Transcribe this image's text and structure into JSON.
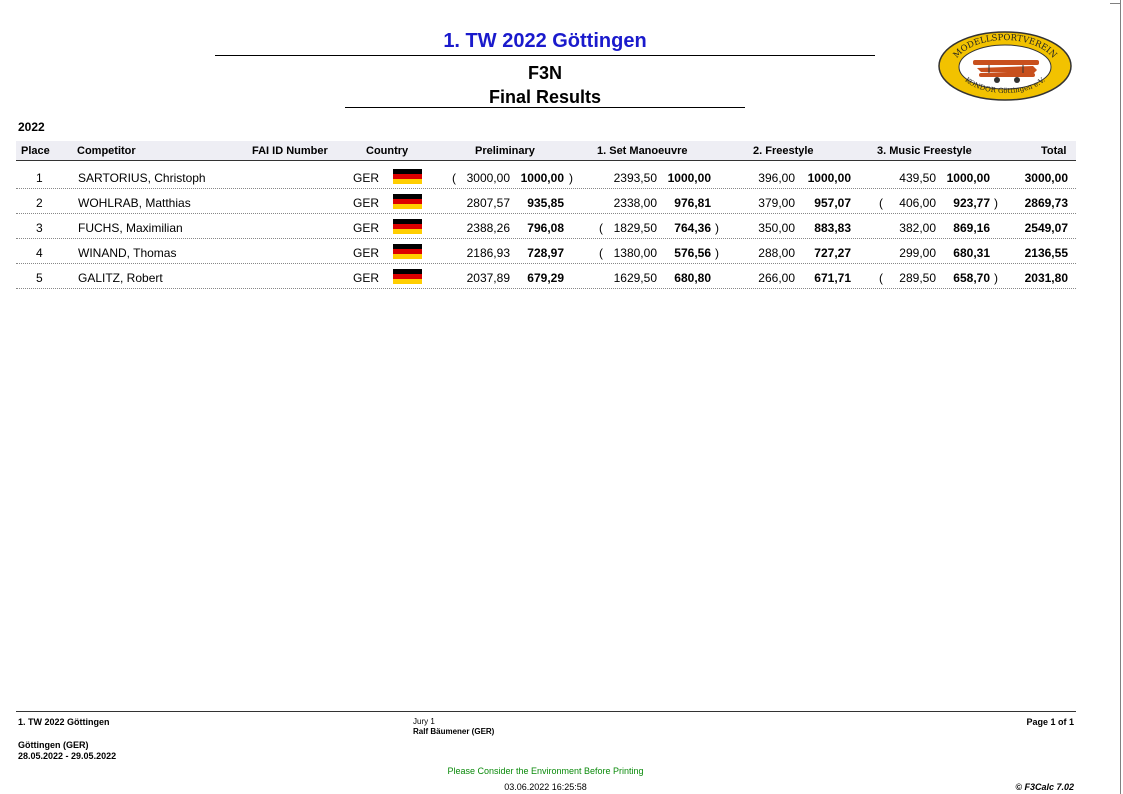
{
  "header": {
    "title": "1. TW 2022 Göttingen",
    "class": "F3N",
    "subtitle": "Final Results",
    "year": "2022",
    "logo": {
      "top_text": "MODELLSPORTVEREIN",
      "bottom_text": "KONDOR Göttingen e.V.",
      "colors": {
        "ring": "#f2c200",
        "outline": "#333333",
        "plane": "#c8501e"
      }
    }
  },
  "table": {
    "columns": {
      "place": "Place",
      "competitor": "Competitor",
      "fai": "FAI ID Number",
      "country": "Country",
      "preliminary": "Preliminary",
      "set": "1. Set Manoeuvre",
      "freestyle": "2. Freestyle",
      "music": "3. Music Freestyle",
      "total": "Total"
    },
    "rows": [
      {
        "place": "1",
        "name": "SARTORIUS, Christoph",
        "fai": "",
        "country": "GER",
        "pre_raw": "3000,00",
        "pre_norm": "1000,00",
        "pre_dropped": true,
        "set_raw": "2393,50",
        "set_norm": "1000,00",
        "set_dropped": false,
        "free_raw": "396,00",
        "free_norm": "1000,00",
        "free_dropped": false,
        "music_raw": "439,50",
        "music_norm": "1000,00",
        "music_dropped": false,
        "total": "3000,00"
      },
      {
        "place": "2",
        "name": "WOHLRAB, Matthias",
        "fai": "",
        "country": "GER",
        "pre_raw": "2807,57",
        "pre_norm": "935,85",
        "pre_dropped": false,
        "set_raw": "2338,00",
        "set_norm": "976,81",
        "set_dropped": false,
        "free_raw": "379,00",
        "free_norm": "957,07",
        "free_dropped": false,
        "music_raw": "406,00",
        "music_norm": "923,77",
        "music_dropped": true,
        "total": "2869,73"
      },
      {
        "place": "3",
        "name": "FUCHS, Maximilian",
        "fai": "",
        "country": "GER",
        "pre_raw": "2388,26",
        "pre_norm": "796,08",
        "pre_dropped": false,
        "set_raw": "1829,50",
        "set_norm": "764,36",
        "set_dropped": true,
        "free_raw": "350,00",
        "free_norm": "883,83",
        "free_dropped": false,
        "music_raw": "382,00",
        "music_norm": "869,16",
        "music_dropped": false,
        "total": "2549,07"
      },
      {
        "place": "4",
        "name": "WINAND, Thomas",
        "fai": "",
        "country": "GER",
        "pre_raw": "2186,93",
        "pre_norm": "728,97",
        "pre_dropped": false,
        "set_raw": "1380,00",
        "set_norm": "576,56",
        "set_dropped": true,
        "free_raw": "288,00",
        "free_norm": "727,27",
        "free_dropped": false,
        "music_raw": "299,00",
        "music_norm": "680,31",
        "music_dropped": false,
        "total": "2136,55"
      },
      {
        "place": "5",
        "name": "GALITZ, Robert",
        "fai": "",
        "country": "GER",
        "pre_raw": "2037,89",
        "pre_norm": "679,29",
        "pre_dropped": false,
        "set_raw": "1629,50",
        "set_norm": "680,80",
        "set_dropped": false,
        "free_raw": "266,00",
        "free_norm": "671,71",
        "free_dropped": false,
        "music_raw": "289,50",
        "music_norm": "658,70",
        "music_dropped": true,
        "total": "2031,80"
      }
    ],
    "flag_colors": [
      "#000000",
      "#dd0000",
      "#ffce00"
    ]
  },
  "footer": {
    "event": "1. TW 2022 Göttingen",
    "location": "Göttingen (GER)",
    "dates": "28.05.2022 - 29.05.2022",
    "jury_title": "Jury 1",
    "jury_name": "Ralf Bäumener (GER)",
    "page": "Page 1 of 1",
    "notice": "Please Consider the Environment Before Printing",
    "printed": "03.06.2022 16:25:58",
    "software": "© F3Calc 7.02"
  }
}
